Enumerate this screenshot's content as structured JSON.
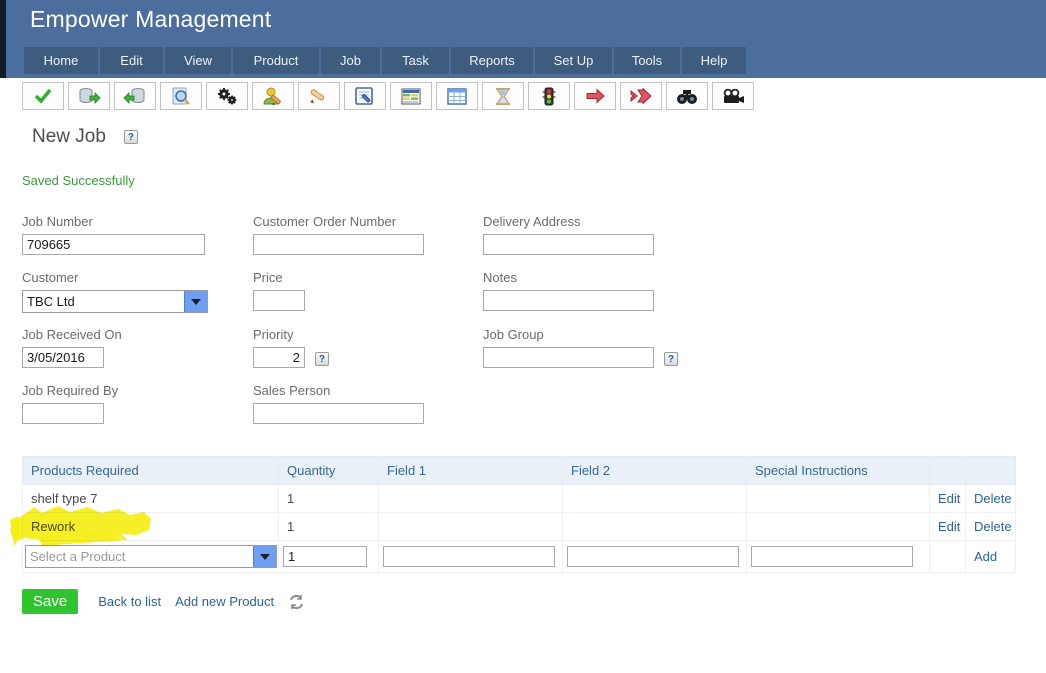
{
  "header": {
    "title": "Empower Management",
    "nav": [
      {
        "label": "Home"
      },
      {
        "label": "Edit"
      },
      {
        "label": "View"
      },
      {
        "label": "Product"
      },
      {
        "label": "Job"
      },
      {
        "label": "Task"
      },
      {
        "label": "Reports"
      },
      {
        "label": "Set Up"
      },
      {
        "label": "Tools"
      },
      {
        "label": "Help"
      }
    ]
  },
  "toolbar": {
    "icons": [
      "check-icon",
      "database-export-icon",
      "database-import-icon",
      "search-document-icon",
      "gears-icon",
      "user-edit-icon",
      "pencil-icon",
      "document-edit-icon",
      "table-colored-icon",
      "table-blue-icon",
      "hourglass-icon",
      "traffic-light-icon",
      "arrow-right-icon",
      "double-arrow-right-icon",
      "binoculars-icon",
      "video-camera-icon"
    ]
  },
  "page": {
    "title": "New Job",
    "help_icon": "?",
    "status_message": "Saved Successfully"
  },
  "form": {
    "job_number": {
      "label": "Job Number",
      "value": "709665"
    },
    "customer": {
      "label": "Customer",
      "value": "TBC Ltd"
    },
    "job_received_on": {
      "label": "Job Received On",
      "value": "3/05/2016"
    },
    "job_required_by": {
      "label": "Job Required By",
      "value": ""
    },
    "customer_order_number": {
      "label": "Customer Order Number",
      "value": ""
    },
    "price": {
      "label": "Price",
      "value": ""
    },
    "priority": {
      "label": "Priority",
      "value": "2",
      "help_icon": "?"
    },
    "sales_person": {
      "label": "Sales Person",
      "value": ""
    },
    "delivery_address": {
      "label": "Delivery Address",
      "value": ""
    },
    "notes": {
      "label": "Notes",
      "value": ""
    },
    "job_group": {
      "label": "Job Group",
      "value": "",
      "help_icon": "?"
    }
  },
  "products_table": {
    "headers": {
      "product": "Products Required",
      "quantity": "Quantity",
      "field1": "Field 1",
      "field2": "Field 2",
      "special_instructions": "Special Instructions"
    },
    "rows": [
      {
        "product": "shelf type 7",
        "quantity": "1",
        "field1": "",
        "field2": "",
        "special_instructions": "",
        "edit_label": "Edit",
        "delete_label": "Delete",
        "highlighted": false
      },
      {
        "product": "Rework",
        "quantity": "1",
        "field1": "",
        "field2": "",
        "special_instructions": "",
        "edit_label": "Edit",
        "delete_label": "Delete",
        "highlighted": true
      }
    ],
    "new_row": {
      "product_selected": "Select a Product",
      "quantity_value": "1",
      "field1_value": "",
      "field2_value": "",
      "special_instructions_value": "",
      "add_label": "Add"
    }
  },
  "footer": {
    "save_label": "Save",
    "back_to_list_label": "Back to list",
    "add_new_product_label": "Add new Product"
  },
  "colors": {
    "header_bg": "#4b6e9e",
    "nav_bg": "#3d5c7e",
    "table_header_bg": "#eaf0f8",
    "table_header_text": "#35689a",
    "link": "#2a6496",
    "status_green": "#3c9a3c",
    "save_green": "#31c431",
    "dropdown_blue": "#6f9ff0",
    "highlight_yellow": "#f6ee12"
  }
}
